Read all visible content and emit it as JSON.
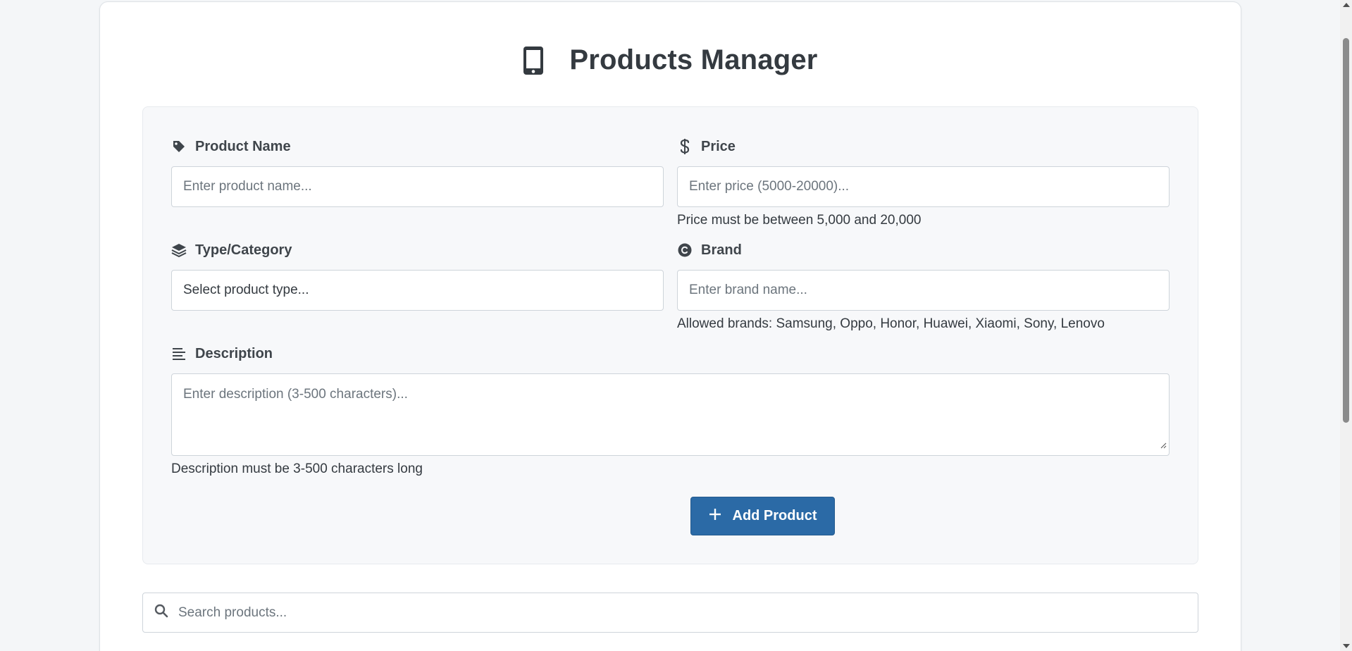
{
  "header": {
    "title": "Products Manager",
    "icon": "mobile-phone-icon"
  },
  "form": {
    "product_name": {
      "label": "Product Name",
      "icon": "tag-icon",
      "placeholder": "Enter product name..."
    },
    "price": {
      "label": "Price",
      "icon": "dollar-icon",
      "placeholder": "Enter price (5000-20000)...",
      "hint": "Price must be between 5,000 and 20,000"
    },
    "type": {
      "label": "Type/Category",
      "icon": "layers-icon",
      "selected": "Select product type..."
    },
    "brand": {
      "label": "Brand",
      "icon": "copyright-icon",
      "placeholder": "Enter brand name...",
      "hint": "Allowed brands: Samsung, Oppo, Honor, Huawei, Xiaomi, Sony, Lenovo"
    },
    "description": {
      "label": "Description",
      "icon": "align-left-icon",
      "placeholder": "Enter description (3-500 characters)...",
      "hint": "Description must be 3-500 characters long"
    },
    "submit_label": "Add Product",
    "submit_icon": "plus-icon"
  },
  "search": {
    "placeholder": "Search products...",
    "icon": "search-icon"
  },
  "colors": {
    "primary": "#2b6aa6",
    "text": "#343a40",
    "panel_bg": "#f7f8fa"
  }
}
